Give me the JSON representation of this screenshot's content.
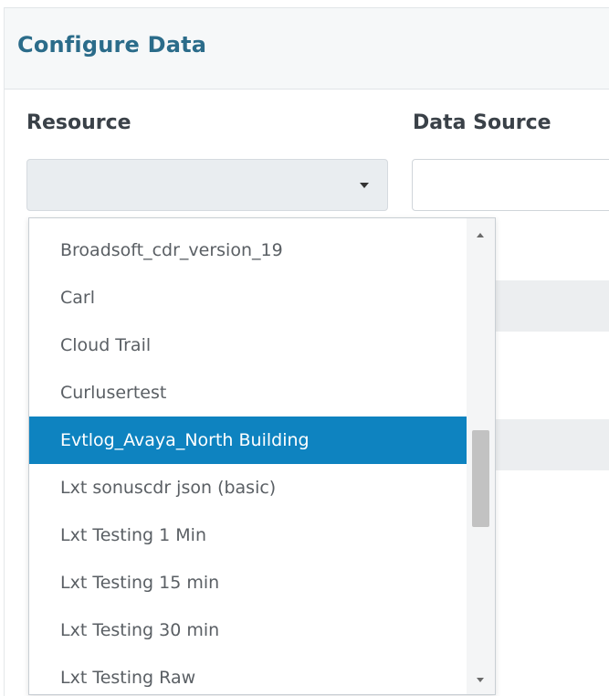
{
  "header": {
    "title": "Configure Data"
  },
  "form": {
    "resource_label": "Resource",
    "resource_value": "",
    "datasource_label": "Data Source",
    "datasource_value": ""
  },
  "dropdown": {
    "options": [
      "Broadsoft_cdr_version_19",
      "Carl",
      "Cloud Trail",
      "Curlusertest",
      "Evtlog_Avaya_North Building",
      "Lxt sonuscdr json (basic)",
      "Lxt Testing 1 Min",
      "Lxt Testing 15 min",
      "Lxt Testing 30 min",
      "Lxt Testing Raw"
    ],
    "selected": "Evtlog_Avaya_North Building"
  },
  "colors": {
    "accent": "#0e83c0",
    "title": "#2b6c8a",
    "header_bg": "#f6f8f9"
  }
}
